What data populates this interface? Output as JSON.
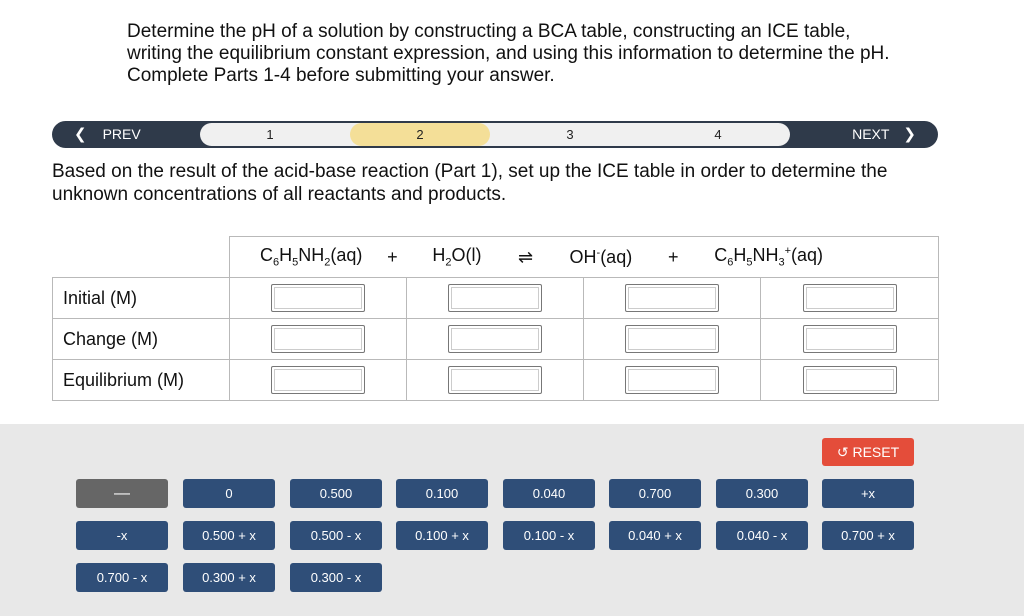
{
  "instructions": "Determine the pH of a solution by constructing a BCA table, constructing an ICE table, writing the equilibrium constant expression, and using this information to determine the pH. Complete Parts 1-4 before submitting your answer.",
  "nav": {
    "prev_label": "PREV",
    "next_label": "NEXT",
    "steps": [
      "1",
      "2",
      "3",
      "4"
    ],
    "active_step": "2"
  },
  "prompt": "Based on the result of the acid-base reaction (Part 1), set up the ICE table in order to determine the unknown concentrations of all reactants and products.",
  "equation": {
    "plus1": "+",
    "arrow": "⇌",
    "plus2": "+"
  },
  "rows": [
    "Initial (M)",
    "Change (M)",
    "Equilibrium (M)"
  ],
  "reset_label": "RESET",
  "tiles": [
    "—",
    "0",
    "0.500",
    "0.100",
    "0.040",
    "0.700",
    "0.300",
    "+x",
    "-x",
    "0.500 + x",
    "0.500 - x",
    "0.100 + x",
    "0.100 - x",
    "0.040 + x",
    "0.040 - x",
    "0.700 + x",
    "0.700 - x",
    "0.300 + x",
    "0.300 - x"
  ]
}
